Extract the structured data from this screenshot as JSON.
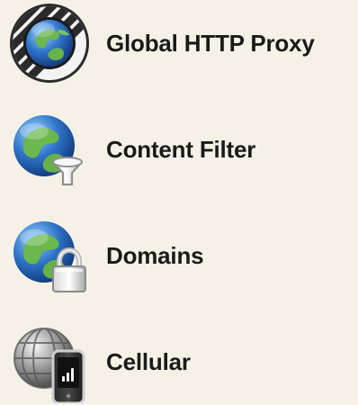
{
  "items": [
    {
      "label": "Global HTTP Proxy",
      "icon": "globe-striped-badge-icon"
    },
    {
      "label": "Content Filter",
      "icon": "globe-funnel-icon"
    },
    {
      "label": "Domains",
      "icon": "globe-lock-icon"
    },
    {
      "label": "Cellular",
      "icon": "globe-phone-signal-icon"
    }
  ],
  "colors": {
    "background": "#f6f1e7",
    "text": "#1a1a1a",
    "globe_blue": "#2f74c8",
    "land_green": "#6bb84f"
  }
}
